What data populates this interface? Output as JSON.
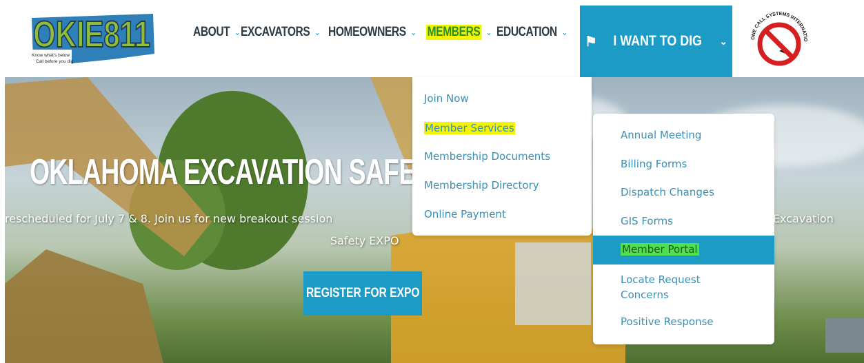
{
  "logo": {
    "main": "OKIE811",
    "tagline_line1": "Know what's below",
    "tagline_line2": "Call before you dig."
  },
  "ocsi_logo": {
    "text": "ONE CALL SYSTEMS INTERNATIONAL"
  },
  "nav": {
    "items": [
      {
        "label": "ABOUT"
      },
      {
        "label": "EXCAVATORS"
      },
      {
        "label": "HOMEOWNERS"
      },
      {
        "label": "MEMBERS"
      },
      {
        "label": "EDUCATION"
      }
    ],
    "dig_button": "I WANT TO DIG"
  },
  "hero": {
    "title": "OKLAHOMA EXCAVATION SAFETY EX",
    "subtitle_left": "rescheduled for July 7 & 8. Join us for new breakout session",
    "subtitle_line2": "Safety EXPO",
    "subtitle_right": "Excavation",
    "register_label": "REGISTER FOR EXPO"
  },
  "members_menu": {
    "items": [
      {
        "label": "Join Now"
      },
      {
        "label": "Member Services"
      },
      {
        "label": "Membership Documents"
      },
      {
        "label": "Membership Directory"
      },
      {
        "label": "Online Payment"
      }
    ]
  },
  "services_menu": {
    "items": [
      {
        "label": "Annual Meeting"
      },
      {
        "label": "Billing Forms"
      },
      {
        "label": "Dispatch Changes"
      },
      {
        "label": "GIS Forms"
      },
      {
        "label": "Member Portal"
      },
      {
        "label": "Locate Request Concerns"
      },
      {
        "label": "Positive Response"
      }
    ]
  },
  "colors": {
    "accent": "#1b9bc6",
    "highlight_yellow": "#f4f400",
    "highlight_green": "#4fe04f",
    "menu_text": "#3a8fb3",
    "nav_text": "#2b3a44"
  }
}
